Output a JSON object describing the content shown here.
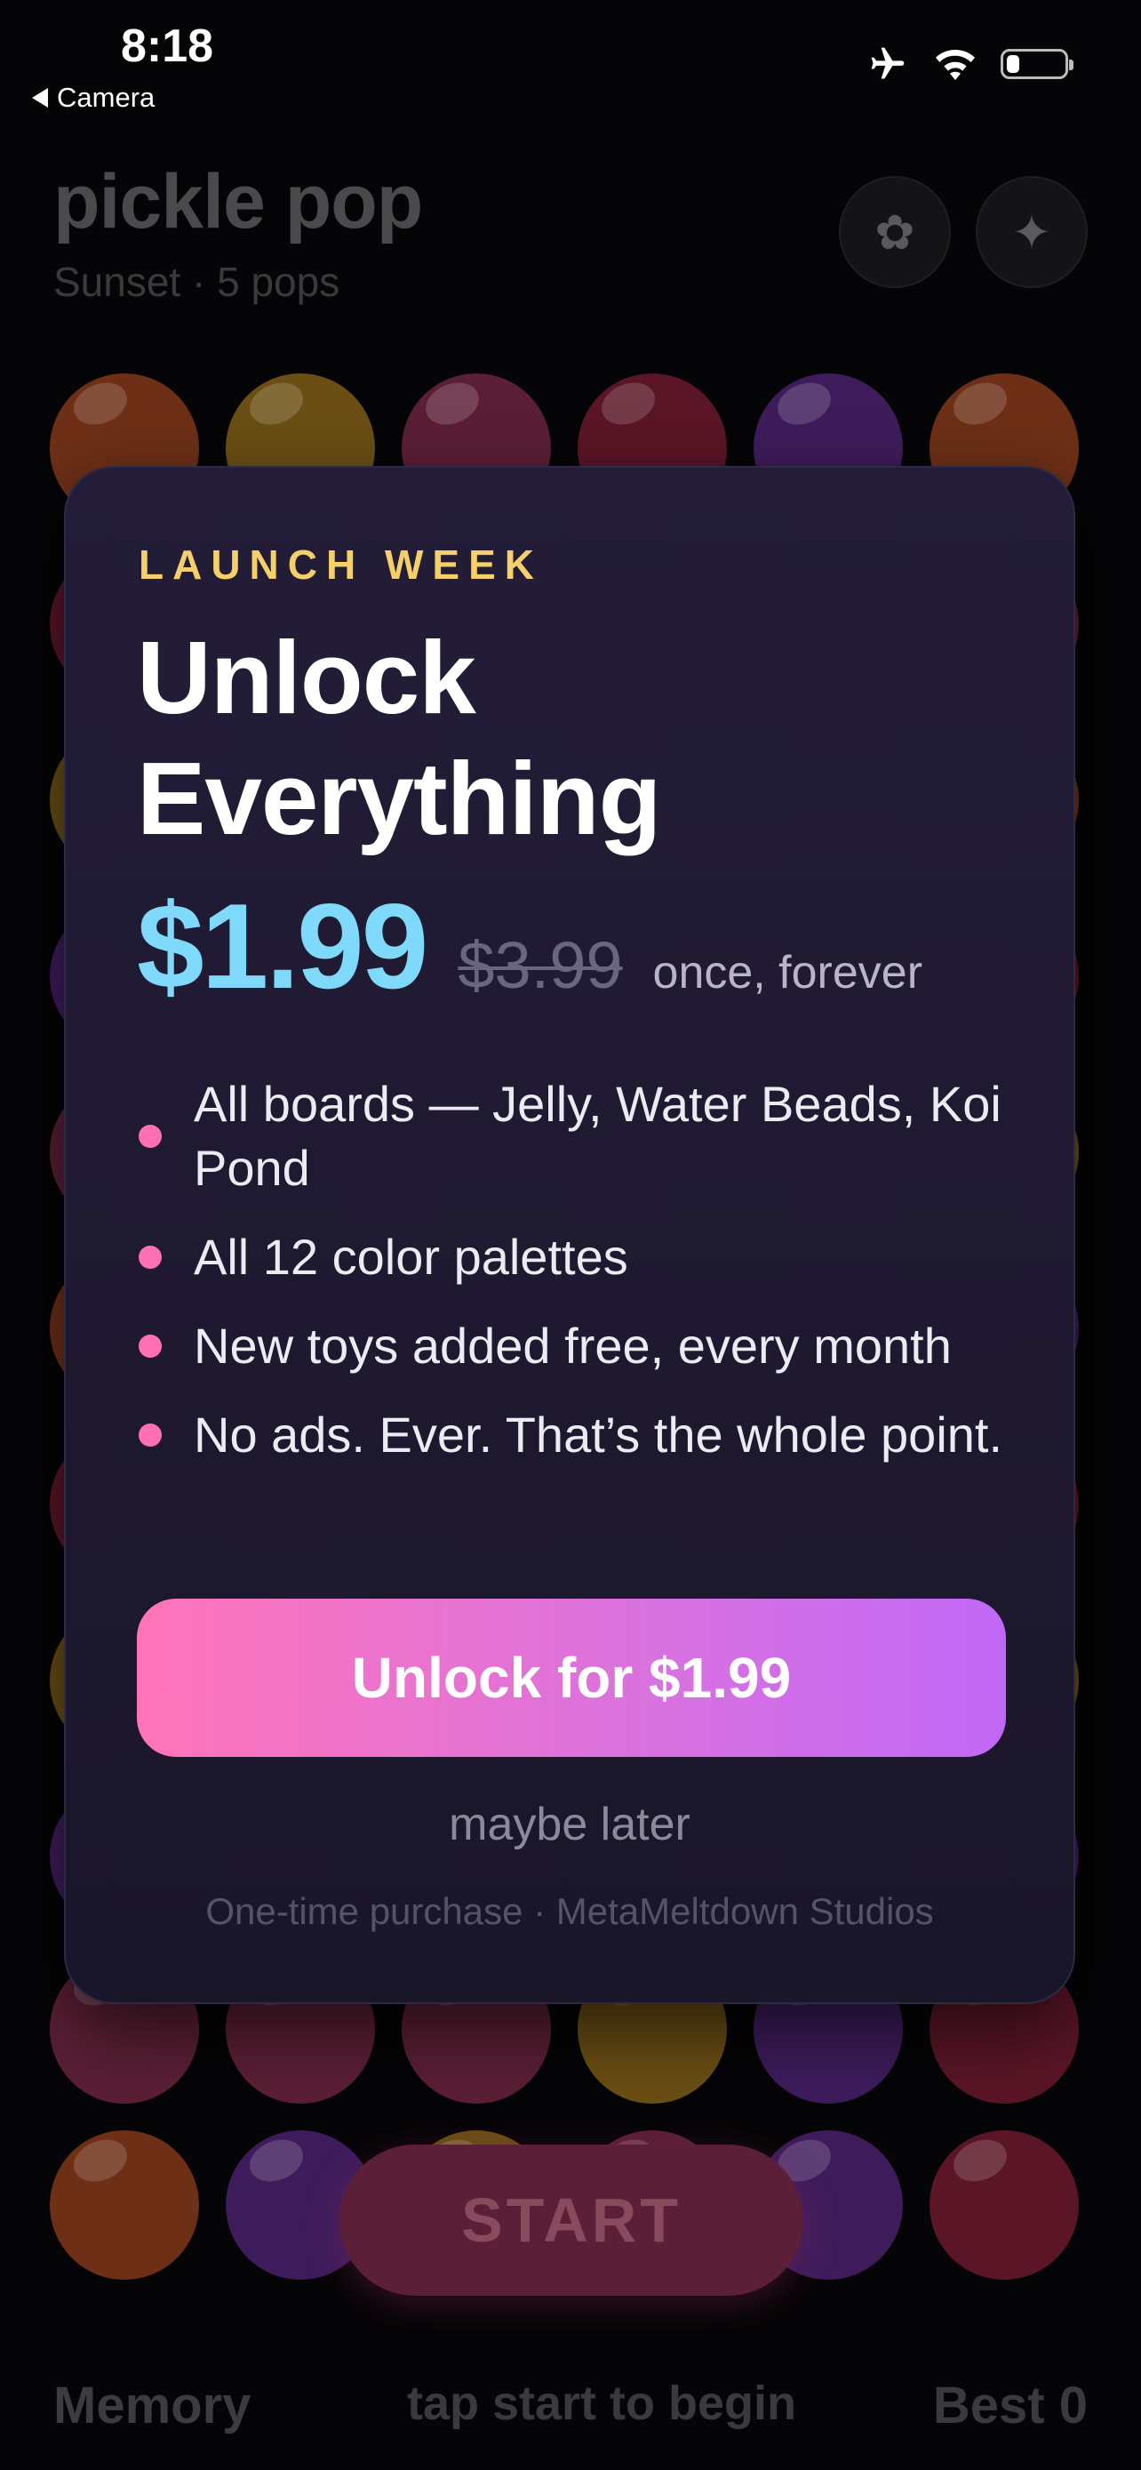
{
  "status": {
    "time": "8:18",
    "back_label": "Camera",
    "battery_level": 0.22
  },
  "header": {
    "title": "pickle pop",
    "subtitle": "Sunset · 5 pops"
  },
  "board": {
    "palette": {
      "orange": "#6d2f16",
      "gold": "#6a4e14",
      "rose": "#5b1f35",
      "crimson": "#5a1526",
      "violet": "#3e1c5c"
    },
    "visible_rows": [
      [
        "orange",
        "gold",
        "rose",
        "crimson",
        "violet",
        "orange"
      ],
      [
        "rose",
        "rose",
        "rose",
        "gold",
        "violet",
        "crimson"
      ],
      [
        "orange",
        "violet",
        "gold",
        "rose",
        "violet",
        "crimson"
      ]
    ]
  },
  "start_label": "START",
  "footer": {
    "mode": "Memory",
    "hint": "tap start to begin",
    "best": "Best 0"
  },
  "modal": {
    "eyebrow": "LAUNCH WEEK",
    "headline": "Unlock Everything",
    "price_new": "$1.99",
    "price_old": "$3.99",
    "price_note": "once, forever",
    "features": [
      "All boards — Jelly, Water Beads, Koi Pond",
      "All 12 color palettes",
      "New toys added free, every month",
      "No ads. Ever. That’s the whole point."
    ],
    "cta_label": "Unlock for $1.99",
    "later_label": "maybe later",
    "fine_print": "One-time purchase · MetaMeltdown Studios"
  },
  "icons": [
    "airplane-icon",
    "wifi-icon",
    "battery-icon",
    "flower-icon",
    "sparkle-icon",
    "back-chevron-icon"
  ]
}
